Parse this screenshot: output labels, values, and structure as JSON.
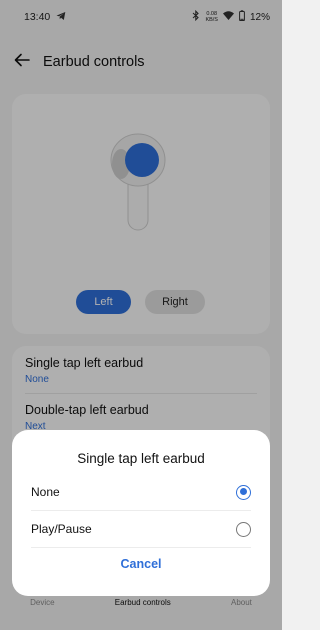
{
  "status_bar": {
    "time": "13:40",
    "net_speed_top": "0.08",
    "net_speed_bottom": "KB/S",
    "battery": "12%",
    "icons": [
      "telegram-icon",
      "bluetooth-icon",
      "wifi-icon",
      "battery-icon"
    ]
  },
  "header": {
    "title": "Earbud controls",
    "back_icon": "arrow-left-icon"
  },
  "preview": {
    "side_toggle": {
      "left": "Left",
      "right": "Right",
      "selected": "Left"
    }
  },
  "settings": {
    "items": [
      {
        "title": "Single tap left earbud",
        "value": "None"
      },
      {
        "title": "Double-tap left earbud",
        "value": "Next"
      }
    ]
  },
  "bottom_nav": {
    "items": [
      "Device",
      "Earbud controls",
      "About"
    ],
    "active": "Earbud controls"
  },
  "dialog": {
    "title": "Single tap left earbud",
    "options": [
      {
        "label": "None",
        "selected": true
      },
      {
        "label": "Play/Pause",
        "selected": false
      }
    ],
    "cancel_label": "Cancel"
  },
  "colors": {
    "accent": "#2f6fd8",
    "background": "#f1f1f1",
    "card": "#fbfbfb"
  }
}
